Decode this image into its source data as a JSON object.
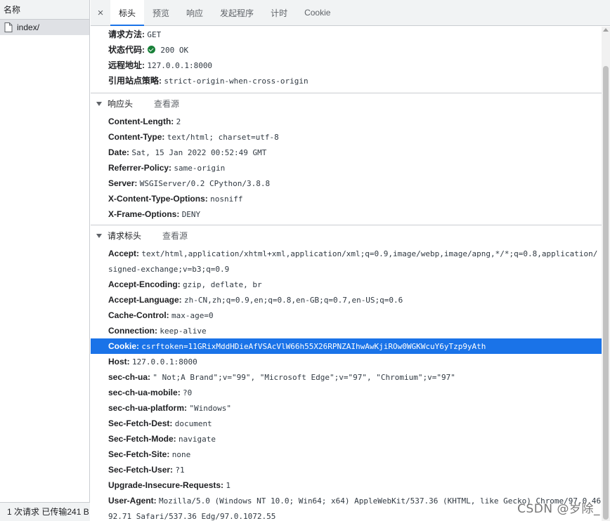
{
  "left_panel": {
    "header": "名称",
    "request_name": "index/",
    "footer": "1 次请求  已传输241 B"
  },
  "tabs": {
    "close": "×",
    "items": [
      "标头",
      "预览",
      "响应",
      "发起程序",
      "计时",
      "Cookie"
    ],
    "active": "标头"
  },
  "general": [
    {
      "key": "请求方法:",
      "value": "GET"
    },
    {
      "key": "状态代码:",
      "value": "200 OK",
      "status_icon": "check-circle-icon"
    },
    {
      "key": "远程地址:",
      "value": "127.0.0.1:8000"
    },
    {
      "key": "引用站点策略:",
      "value": "strict-origin-when-cross-origin"
    }
  ],
  "response_headers": {
    "title": "响应头",
    "view_source": "查看源",
    "rows": [
      {
        "key": "Content-Length:",
        "value": "2"
      },
      {
        "key": "Content-Type:",
        "value": "text/html; charset=utf-8"
      },
      {
        "key": "Date:",
        "value": "Sat, 15 Jan 2022 00:52:49 GMT"
      },
      {
        "key": "Referrer-Policy:",
        "value": "same-origin"
      },
      {
        "key": "Server:",
        "value": "WSGIServer/0.2 CPython/3.8.8"
      },
      {
        "key": "X-Content-Type-Options:",
        "value": "nosniff"
      },
      {
        "key": "X-Frame-Options:",
        "value": "DENY"
      }
    ]
  },
  "request_headers": {
    "title": "请求标头",
    "view_source": "查看源",
    "accept": {
      "key": "Accept:",
      "value_line1": "text/html,application/xhtml+xml,application/xml;q=0.9,image/webp,image/apng,*/*;q=0.8,application/",
      "value_line2": "signed-exchange;v=b3;q=0.9"
    },
    "rows": [
      {
        "key": "Accept-Encoding:",
        "value": "gzip, deflate, br"
      },
      {
        "key": "Accept-Language:",
        "value": "zh-CN,zh;q=0.9,en;q=0.8,en-GB;q=0.7,en-US;q=0.6"
      },
      {
        "key": "Cache-Control:",
        "value": "max-age=0"
      },
      {
        "key": "Connection:",
        "value": "keep-alive"
      },
      {
        "key": "Cookie:",
        "value": "csrftoken=11GRixMddHDieAfVSAcVlW66h55X26RPNZAIhwAwKjiROw0WGKWcuY6yTzp9yAth",
        "selected": true
      },
      {
        "key": "Host:",
        "value": "127.0.0.1:8000"
      },
      {
        "key": "sec-ch-ua:",
        "value": "\" Not;A Brand\";v=\"99\", \"Microsoft Edge\";v=\"97\", \"Chromium\";v=\"97\""
      },
      {
        "key": "sec-ch-ua-mobile:",
        "value": "?0"
      },
      {
        "key": "sec-ch-ua-platform:",
        "value": "\"Windows\""
      },
      {
        "key": "Sec-Fetch-Dest:",
        "value": "document"
      },
      {
        "key": "Sec-Fetch-Mode:",
        "value": "navigate"
      },
      {
        "key": "Sec-Fetch-Site:",
        "value": "none"
      },
      {
        "key": "Sec-Fetch-User:",
        "value": "?1"
      },
      {
        "key": "Upgrade-Insecure-Requests:",
        "value": "1"
      }
    ],
    "user_agent": {
      "key": "User-Agent:",
      "value_line1": "Mozilla/5.0 (Windows NT 10.0; Win64; x64) AppleWebKit/537.36 (KHTML, like Gecko) Chrome/97.0.46",
      "value_line2": "92.71 Safari/537.36 Edg/97.0.1072.55"
    }
  },
  "watermark": "CSDN @岁除_",
  "colors": {
    "selection": "#1a73e8",
    "status_ok": "#188038",
    "panel_bg": "#f1f3f4"
  }
}
